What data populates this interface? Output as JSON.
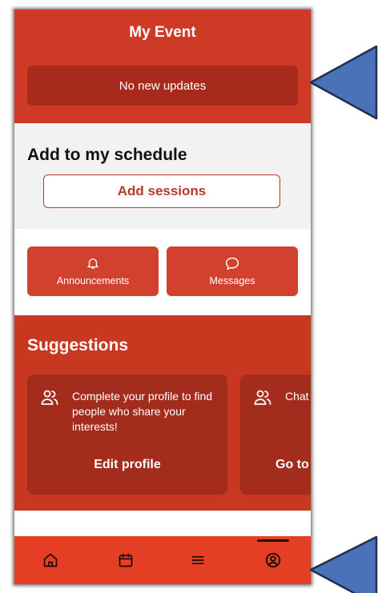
{
  "header": {
    "title": "My Event",
    "updates_text": "No new updates"
  },
  "schedule": {
    "heading": "Add to my schedule",
    "add_sessions_label": "Add sessions"
  },
  "actions": [
    {
      "label": "Announcements",
      "icon": "bell-icon"
    },
    {
      "label": "Messages",
      "icon": "chat-bubble-icon"
    }
  ],
  "suggestions": {
    "heading": "Suggestions",
    "cards": [
      {
        "icon": "people-icon",
        "text": "Complete your profile to find people who share your interests!",
        "link_label": "Edit profile"
      },
      {
        "icon": "people-icon",
        "text": "Chat eve",
        "link_label": "Go to"
      }
    ]
  },
  "nav": [
    {
      "name": "home",
      "icon": "home-icon"
    },
    {
      "name": "schedule",
      "icon": "calendar-icon"
    },
    {
      "name": "menu",
      "icon": "menu-icon"
    },
    {
      "name": "profile",
      "icon": "profile-icon",
      "active": true
    }
  ],
  "colors": {
    "header_bg": "#cf3a27",
    "updates_bg": "#a82a1c",
    "section_bg": "#f2f2f2",
    "action_bg": "#d2412d",
    "suggestions_bg": "#c8371f",
    "card_bg": "#a42c1c",
    "nav_bg": "#e43f25",
    "pointer": "#4a72b8"
  }
}
